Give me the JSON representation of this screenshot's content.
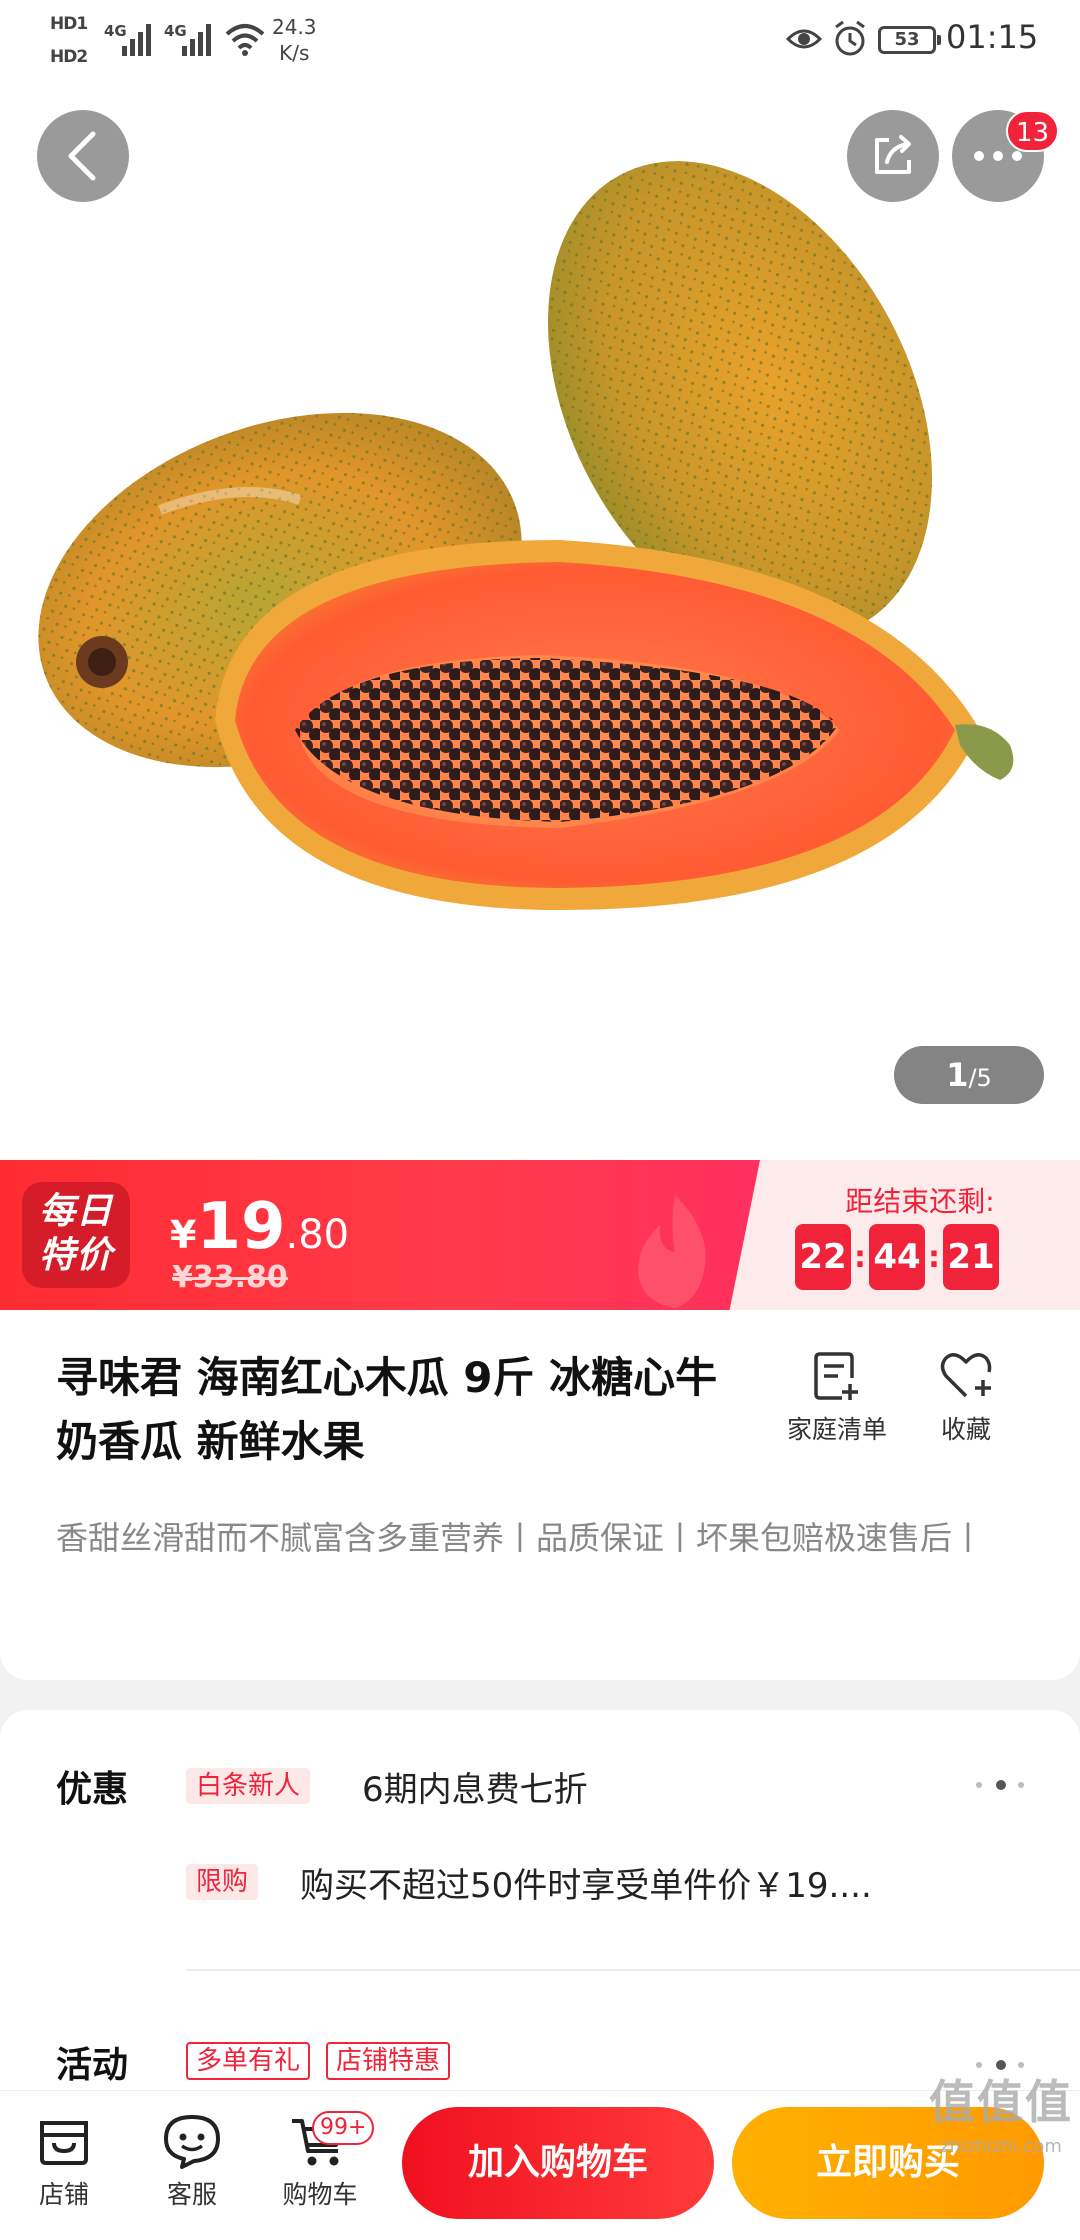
{
  "status_bar": {
    "hd1": "HD1",
    "hd2": "HD2",
    "network1": "4G",
    "network2": "4G",
    "speed_value": "24.3",
    "speed_unit": "K/s",
    "battery": "53",
    "time": "01:15",
    "icons": [
      "signal-icon",
      "wifi-icon",
      "eye-icon",
      "alarm-icon",
      "battery-icon"
    ]
  },
  "hero": {
    "more_badge": "13",
    "image_current": "1",
    "image_total": "/5",
    "icons": [
      "back-icon",
      "share-icon",
      "more-icon"
    ]
  },
  "flash_sale": {
    "logo_line1": "每日",
    "logo_line2": "特价",
    "currency": "¥",
    "price_int": "19",
    "price_dec": ".80",
    "original_price": "¥33.80",
    "countdown_label": "距结束还剩:",
    "hours": "22",
    "minutes": "44",
    "seconds": "21",
    "colors": {
      "primary": "#f0233a",
      "light_bg": "#fdeaea"
    }
  },
  "product": {
    "title": "寻味君 海南红心木瓜 9斤 冰糖心牛奶香瓜 新鲜水果",
    "family_list_label": "家庭清单",
    "favorite_label": "收藏",
    "description": "香甜丝滑甜而不腻富含多重营养丨品质保证丨坏果包赔极速售后丨"
  },
  "promotions": {
    "discount_label": "优惠",
    "discount_tag": "白条新人",
    "discount_text": "6期内息费七折",
    "limit_tag": "限购",
    "limit_text": "购买不超过50件时享受单件价￥19....",
    "activity_label": "活动",
    "activity_tags": [
      "多单有礼",
      "店铺特惠"
    ]
  },
  "bottom_bar": {
    "store_label": "店铺",
    "service_label": "客服",
    "cart_label": "购物车",
    "cart_badge": "99+",
    "add_to_cart": "加入购物车",
    "buy_now": "立即购买",
    "colors": {
      "add_to_cart": "#f0101f",
      "buy_now": "#ffa800"
    }
  },
  "watermark": {
    "logo": "值值值",
    "url": "zhizhizhi.com"
  }
}
